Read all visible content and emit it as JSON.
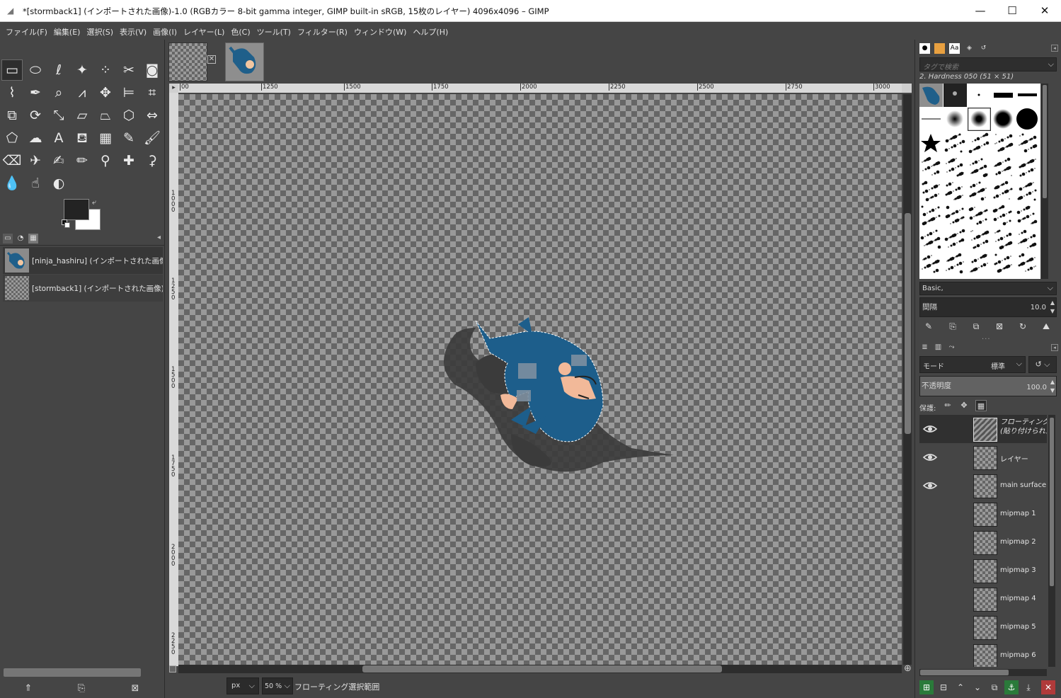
{
  "window": {
    "title": "*[stormback1] (インポートされた画像)-1.0 (RGBカラー 8-bit gamma integer, GIMP built-in sRGB, 15枚のレイヤー) 4096x4096 – GIMP",
    "minimize": "—",
    "maximize": "☐",
    "close": "✕"
  },
  "menu": [
    "ファイル(F)",
    "編集(E)",
    "選択(S)",
    "表示(V)",
    "画像(I)",
    "レイヤー(L)",
    "色(C)",
    "ツール(T)",
    "フィルター(R)",
    "ウィンドウ(W)",
    "ヘルプ(H)"
  ],
  "toolbox": {
    "tools": [
      {
        "name": "rect-select-icon",
        "glyph": "▭"
      },
      {
        "name": "ellipse-select-icon",
        "glyph": "⬭"
      },
      {
        "name": "free-select-icon",
        "glyph": "ℓ"
      },
      {
        "name": "fuzzy-select-icon",
        "glyph": "✦"
      },
      {
        "name": "by-color-select-icon",
        "glyph": "⁘"
      },
      {
        "name": "scissors-select-icon",
        "glyph": "✂"
      },
      {
        "name": "foreground-select-icon",
        "glyph": "◙"
      },
      {
        "name": "paths-icon",
        "glyph": "⌇"
      },
      {
        "name": "color-picker-icon",
        "glyph": "✒"
      },
      {
        "name": "zoom-icon",
        "glyph": "⌕"
      },
      {
        "name": "measure-icon",
        "glyph": "⩘"
      },
      {
        "name": "move-icon",
        "glyph": "✥"
      },
      {
        "name": "align-icon",
        "glyph": "⊨"
      },
      {
        "name": "crop-icon",
        "glyph": "⌗"
      },
      {
        "name": "unified-transform-icon",
        "glyph": "⧉"
      },
      {
        "name": "rotate-icon",
        "glyph": "⟳"
      },
      {
        "name": "scale-icon",
        "glyph": "⤡"
      },
      {
        "name": "shear-icon",
        "glyph": "▱"
      },
      {
        "name": "perspective-icon",
        "glyph": "⏢"
      },
      {
        "name": "3d-transform-icon",
        "glyph": "⬡"
      },
      {
        "name": "flip-icon",
        "glyph": "⇔"
      },
      {
        "name": "cage-transform-icon",
        "glyph": "⬠"
      },
      {
        "name": "warp-transform-icon",
        "glyph": "☁"
      },
      {
        "name": "text-icon",
        "glyph": "A"
      },
      {
        "name": "bucket-fill-icon",
        "glyph": "⛾"
      },
      {
        "name": "gradient-icon",
        "glyph": "▦"
      },
      {
        "name": "pencil-icon",
        "glyph": "✎"
      },
      {
        "name": "paintbrush-icon",
        "glyph": "🖌"
      },
      {
        "name": "eraser-icon",
        "glyph": "⌫"
      },
      {
        "name": "airbrush-icon",
        "glyph": "✈"
      },
      {
        "name": "ink-icon",
        "glyph": "✍"
      },
      {
        "name": "mypaint-brush-icon",
        "glyph": "✏"
      },
      {
        "name": "clone-icon",
        "glyph": "⚲"
      },
      {
        "name": "heal-icon",
        "glyph": "✚"
      },
      {
        "name": "perspective-clone-icon",
        "glyph": "⚳"
      },
      {
        "name": "blur-icon",
        "glyph": "💧"
      },
      {
        "name": "smudge-icon",
        "glyph": "☝"
      },
      {
        "name": "dodge-burn-icon",
        "glyph": "◐"
      }
    ]
  },
  "images_dock": {
    "tab_icons": [
      "images-tab-icon",
      "document-history-tab-icon",
      "templates-tab-icon"
    ],
    "items": [
      {
        "label": "[ninja_hashiru] (インポートされた画像)"
      },
      {
        "label": "[stormback1] (インポートされた画像)"
      }
    ]
  },
  "canvas": {
    "ruler_h": [
      "00",
      "1250",
      "1500",
      "1750",
      "2000",
      "2250",
      "2500",
      "2750",
      "3000"
    ],
    "ruler_v": [
      "1000",
      "1250",
      "1500",
      "1750",
      "2000",
      "2250"
    ],
    "navigate_glyph": "⊕"
  },
  "statusbar": {
    "unit": "px",
    "zoom": "50 %",
    "message": "フローティング選択範囲"
  },
  "brushes": {
    "tab_icons": [
      "brushes-tab-icon",
      "patterns-tab-icon",
      "fonts-tab-icon",
      "paint-dynamics-tab-icon",
      "tool-presets-tab-icon"
    ],
    "tag_placeholder": "タグで検索",
    "selected_name": "2. Hardness 050 (51 × 51)",
    "preset": "Basic,",
    "spacing_label": "間隔",
    "spacing_value": "10.0"
  },
  "layers": {
    "tab_icons": [
      "layers-tab-icon",
      "channels-tab-icon",
      "paths-tab-icon"
    ],
    "mode_label": "モード",
    "mode_value": "標準",
    "opacity_label": "不透明度",
    "opacity_value": "100.0",
    "lock_label": "保護:",
    "items": [
      {
        "name": "フローティング選択範囲",
        "line2": "(貼り付けられたレイヤー)",
        "visible": true,
        "selected": true
      },
      {
        "name": "レイヤー",
        "visible": true
      },
      {
        "name": "main surface",
        "visible": true
      },
      {
        "name": "mipmap 1",
        "visible": false
      },
      {
        "name": "mipmap 2",
        "visible": false
      },
      {
        "name": "mipmap 3",
        "visible": false
      },
      {
        "name": "mipmap 4",
        "visible": false
      },
      {
        "name": "mipmap 5",
        "visible": false
      },
      {
        "name": "mipmap 6",
        "visible": false
      }
    ]
  }
}
